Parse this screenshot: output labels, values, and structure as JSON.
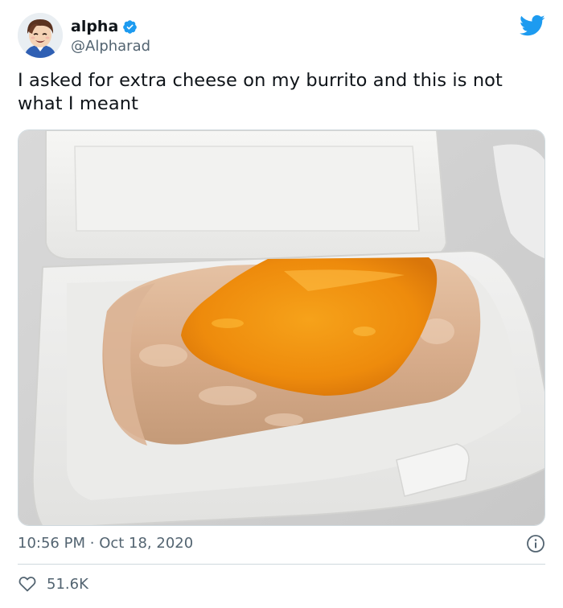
{
  "author": {
    "display_name": "alpha",
    "handle": "@Alpharad",
    "verified": true
  },
  "tweet": {
    "text": "I asked for extra cheese on my burrito and this is not what I meant",
    "time": "10:56 PM",
    "separator": "·",
    "date": "Oct 18, 2020",
    "likes": "51.6K"
  },
  "colors": {
    "brand_blue": "#1d9bf0",
    "secondary_text": "#536471",
    "border": "#cfd9de"
  },
  "icons": {
    "verified": "verified-badge-icon",
    "logo": "twitter-bird-icon",
    "info": "info-icon",
    "like": "heart-icon"
  }
}
